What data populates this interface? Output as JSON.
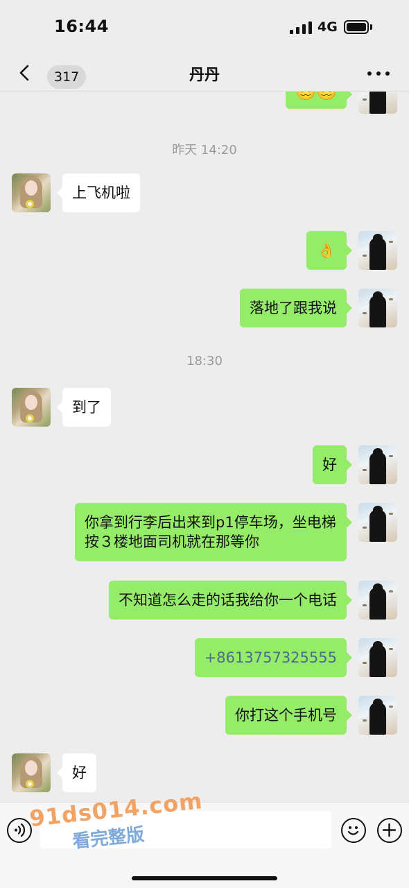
{
  "status_bar": {
    "time": "16:44",
    "network": "4G"
  },
  "nav": {
    "unread_count": "317",
    "title": "丹丹"
  },
  "messages": [
    {
      "side": "out",
      "text": "😵‍💫😵‍💫"
    },
    {
      "type": "timestamp",
      "text": "昨天 14:20"
    },
    {
      "side": "in",
      "text": "上飞机啦"
    },
    {
      "side": "out",
      "text": "👌"
    },
    {
      "side": "out",
      "text": "落地了跟我说"
    },
    {
      "type": "timestamp",
      "text": "18:30"
    },
    {
      "side": "in",
      "text": "到了"
    },
    {
      "side": "out",
      "text": "好"
    },
    {
      "side": "out",
      "text": "你拿到行李后出来到p1停车场，坐电梯按３楼地面司机就在那等你"
    },
    {
      "side": "out",
      "text": "不知道怎么走的话我给你一个电话"
    },
    {
      "side": "out",
      "text": "+8613757325555"
    },
    {
      "side": "out",
      "text": "你打这个手机号"
    },
    {
      "side": "in",
      "text": "好"
    }
  ],
  "input": {
    "placeholder": ""
  },
  "watermark": {
    "line1": "91ds014.com",
    "line2": "看完整版"
  },
  "colors": {
    "background": "#ededed",
    "outgoing_bubble": "#95ec69",
    "incoming_bubble": "#ffffff",
    "phone_link": "#4b6a8f"
  },
  "icons": [
    "chevron-left-icon",
    "more-icon",
    "voice-icon",
    "emoji-icon",
    "plus-icon",
    "signal-icon",
    "battery-icon"
  ]
}
